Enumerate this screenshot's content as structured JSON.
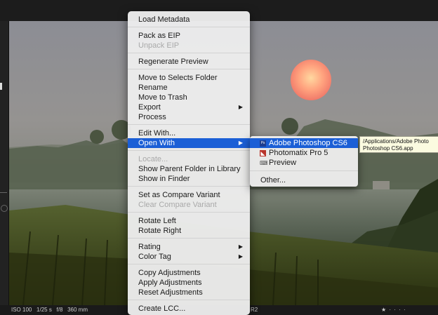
{
  "info_bar": {
    "iso": "ISO 100",
    "shutter": "1/25 s",
    "aperture": "f/8",
    "focal_length": "360 mm",
    "filename_fragment": "R2",
    "rating_indicator": "★ · · · ·"
  },
  "context_menu": {
    "groups": [
      [
        {
          "label": "Load Metadata",
          "enabled": true
        }
      ],
      [
        {
          "label": "Pack as EIP",
          "enabled": true
        },
        {
          "label": "Unpack EIP",
          "enabled": false
        }
      ],
      [
        {
          "label": "Regenerate Preview",
          "enabled": true
        }
      ],
      [
        {
          "label": "Move to Selects Folder",
          "enabled": true
        },
        {
          "label": "Rename",
          "enabled": true
        },
        {
          "label": "Move to Trash",
          "enabled": true
        },
        {
          "label": "Export",
          "enabled": true,
          "submenu": true
        },
        {
          "label": "Process",
          "enabled": true
        }
      ],
      [
        {
          "label": "Edit With...",
          "enabled": true
        },
        {
          "label": "Open With",
          "enabled": true,
          "submenu": true,
          "highlighted": true
        }
      ],
      [
        {
          "label": "Locate...",
          "enabled": false
        },
        {
          "label": "Show Parent Folder in Library",
          "enabled": true
        },
        {
          "label": "Show in Finder",
          "enabled": true
        }
      ],
      [
        {
          "label": "Set as Compare Variant",
          "enabled": true
        },
        {
          "label": "Clear Compare Variant",
          "enabled": false
        }
      ],
      [
        {
          "label": "Rotate Left",
          "enabled": true
        },
        {
          "label": "Rotate Right",
          "enabled": true
        }
      ],
      [
        {
          "label": "Rating",
          "enabled": true,
          "submenu": true
        },
        {
          "label": "Color Tag",
          "enabled": true,
          "submenu": true
        }
      ],
      [
        {
          "label": "Copy Adjustments",
          "enabled": true
        },
        {
          "label": "Apply Adjustments",
          "enabled": true
        },
        {
          "label": "Reset Adjustments",
          "enabled": true
        }
      ],
      [
        {
          "label": "Create LCC...",
          "enabled": true
        }
      ]
    ]
  },
  "open_with_submenu": {
    "apps": [
      {
        "label": "Adobe Photoshop CS6",
        "icon": "photoshop-icon",
        "highlighted": true
      },
      {
        "label": "Photomatix Pro 5",
        "icon": "photomatix-icon"
      },
      {
        "label": "Preview",
        "icon": "preview-icon"
      }
    ],
    "other_label": "Other..."
  },
  "tooltip": {
    "line1": "/Applications/Adobe Photo",
    "line2": "Photoshop CS6.app"
  },
  "colors": {
    "menu_bg": "#ececec",
    "highlight": "#1b5fd6",
    "disabled_text": "#a9a9a9",
    "sun_center": "#ffd49a",
    "sun_edge": "#f07a6a"
  }
}
